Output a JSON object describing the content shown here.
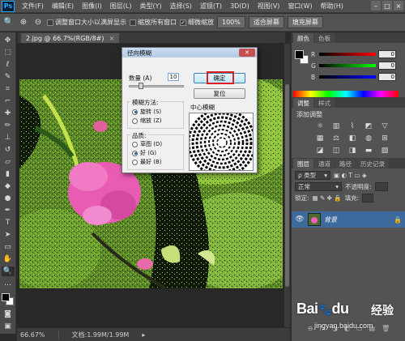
{
  "app": {
    "logo": "Ps"
  },
  "menu": [
    "文件(F)",
    "编辑(E)",
    "图像(I)",
    "图层(L)",
    "类型(Y)",
    "选择(S)",
    "滤镜(T)",
    "3D(D)",
    "视图(V)",
    "窗口(W)",
    "帮助(H)"
  ],
  "window_controls": [
    "–",
    "□",
    "×"
  ],
  "options": {
    "check1": "调整窗口大小以满屏显示",
    "check2": "缩放所有窗口",
    "check3": "细微缩放",
    "btn_100": "100%",
    "btn_fit": "适合屏幕",
    "btn_fill": "填充屏幕",
    "check3_checked": true
  },
  "document": {
    "tab_title": "2.jpg @ 66.7%(RGB/8#)",
    "close": "×"
  },
  "status": {
    "zoom": "66.67%",
    "doc": "文档:1.99M/1.99M"
  },
  "dialog": {
    "title": "径向模糊",
    "close": "✕",
    "amount_label": "数量 (A)",
    "amount_value": "10",
    "ok_label": "确定",
    "reset_label": "复位",
    "method_label": "模糊方法:",
    "method_options": [
      "旋转 (S)",
      "缩放 (Z)"
    ],
    "method_selected": 0,
    "quality_label": "品质:",
    "quality_options": [
      "草图 (D)",
      "好 (G)",
      "最好 (B)"
    ],
    "quality_selected": 1,
    "center_label": "中心模糊"
  },
  "panels": {
    "color_tabs": [
      "颜色",
      "色板"
    ],
    "color_rows": [
      {
        "label": "R",
        "value": "0",
        "gradient": "linear-gradient(to right,#000,#f00)"
      },
      {
        "label": "G",
        "value": "0",
        "gradient": "linear-gradient(to right,#000,#0f0)"
      },
      {
        "label": "B",
        "value": "0",
        "gradient": "linear-gradient(to right,#000,#00f)"
      }
    ],
    "adjust_tabs": [
      "调整",
      "样式"
    ],
    "adjust_title": "添加调整",
    "layers_tabs": [
      "图层",
      "通道",
      "路径",
      "历史记录"
    ],
    "kind_label": "ρ 类型",
    "blend_mode": "正常",
    "opacity_label": "不透明度:",
    "lock_label": "锁定:",
    "fill_label": "填充:",
    "layer_name": "背景",
    "footer_icons": [
      "⊖",
      "fx",
      "◑",
      "◐",
      "▭",
      "▤",
      "🗑"
    ]
  },
  "colors": {
    "ok_highlight": "#e02020",
    "layer_selected": "#3d6a9c",
    "ui_dark": "#535353"
  },
  "watermark": {
    "brand": "Bai",
    "brand2": "du",
    "cn": "经验",
    "url": "jingyan.baidu.com"
  }
}
